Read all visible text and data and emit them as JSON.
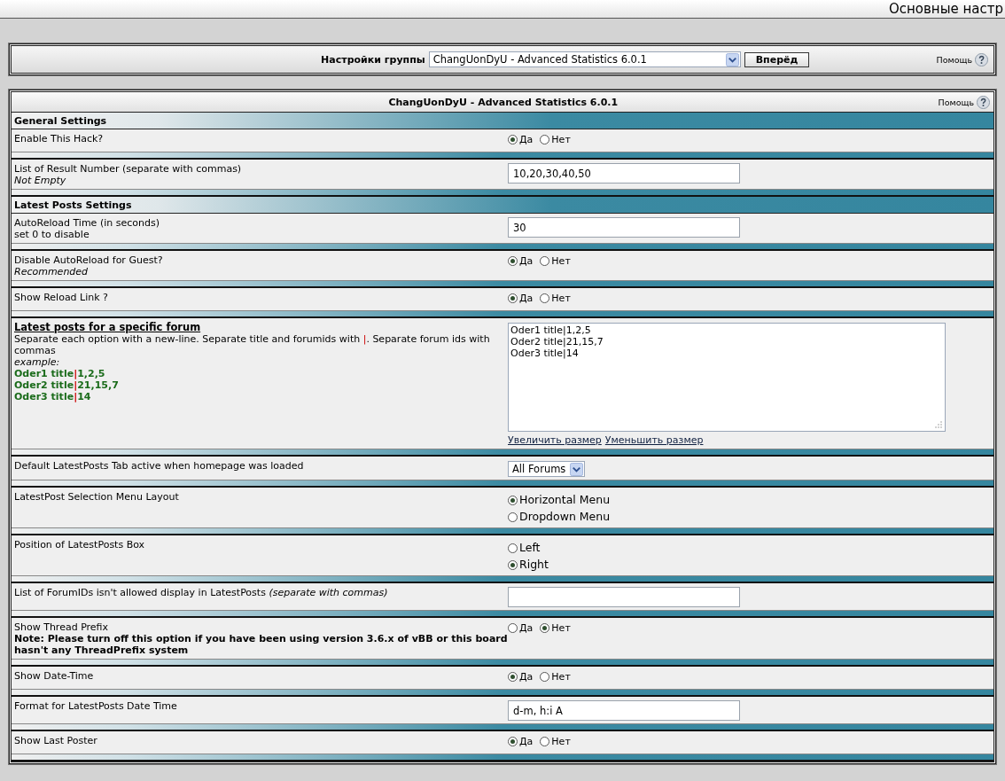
{
  "page_title": "Основные настр",
  "group_bar": {
    "label": "Настройки группы",
    "select": "ChangUonDyU - Advanced Statistics 6.0.1",
    "button": "Вперёд",
    "help": "Помощь"
  },
  "panel": {
    "title": "ChangUonDyU - Advanced Statistics 6.0.1",
    "help": "Помощь"
  },
  "rows": [
    {
      "kind": "section",
      "title": "General Settings"
    },
    {
      "kind": "radio",
      "desc": [
        {
          "kind": "label",
          "text": "Enable This Hack?"
        }
      ],
      "options": [
        {
          "label": "Да",
          "selected": true
        },
        {
          "label": "Нет",
          "selected": false
        }
      ]
    },
    {
      "kind": "text",
      "desc": [
        {
          "kind": "label",
          "text": "List of Result Number (separate with commas)"
        },
        {
          "kind": "hint",
          "text": "Not Empty"
        }
      ],
      "value": "10,20,30,40,50"
    },
    {
      "kind": "section",
      "title": "Latest Posts Settings"
    },
    {
      "kind": "text",
      "desc": [
        {
          "kind": "label",
          "text": "AutoReload Time (in seconds)"
        },
        {
          "kind": "label",
          "text": "set 0 to disable"
        }
      ],
      "value": "30"
    },
    {
      "kind": "radio",
      "desc": [
        {
          "kind": "label",
          "text": "Disable AutoReload for Guest?"
        },
        {
          "kind": "hint",
          "text": "Recommended"
        }
      ],
      "options": [
        {
          "label": "Да",
          "selected": true
        },
        {
          "label": "Нет",
          "selected": false
        }
      ]
    },
    {
      "kind": "radio",
      "desc": [
        {
          "kind": "label",
          "text": "Show Reload Link ?"
        }
      ],
      "options": [
        {
          "label": "Да",
          "selected": true
        },
        {
          "label": "Нет",
          "selected": false
        }
      ]
    },
    {
      "kind": "textarea",
      "desc": [
        {
          "kind": "heading",
          "text": "Latest posts for a specific forum"
        },
        {
          "kind": "sentence",
          "before": "Separate each option with a new-line. Separate title and forumids with ",
          "sep": "|",
          "after": ". Separate forum ids with commas"
        },
        {
          "kind": "hint",
          "text": "example:"
        },
        {
          "kind": "example",
          "before": "Oder1 title",
          "sep": "|",
          "after": "1,2,5"
        },
        {
          "kind": "example",
          "before": "Oder2 title",
          "sep": "|",
          "after": "21,15,7"
        },
        {
          "kind": "example",
          "before": "Oder3 title",
          "sep": "|",
          "after": "14"
        }
      ],
      "lines": [
        "Oder1 title|1,2,5",
        "Oder2 title|21,15,7",
        "Oder3 title|14"
      ],
      "links": [
        "Увеличить размер",
        "Уменьшить размер"
      ]
    },
    {
      "kind": "select",
      "desc": [
        {
          "kind": "label",
          "text": "Default LatestPosts Tab active when homepage was loaded"
        }
      ],
      "value": "All Forums"
    },
    {
      "kind": "radio_stack",
      "desc": [
        {
          "kind": "label",
          "text": "LatestPost Selection Menu Layout"
        }
      ],
      "options": [
        {
          "label": "Horizontal Menu",
          "selected": true
        },
        {
          "label": "Dropdown Menu",
          "selected": false
        }
      ]
    },
    {
      "kind": "radio_stack",
      "desc": [
        {
          "kind": "label",
          "text": "Position of LatestPosts Box"
        }
      ],
      "options": [
        {
          "label": "Left",
          "selected": false
        },
        {
          "label": "Right",
          "selected": true
        }
      ]
    },
    {
      "kind": "text",
      "desc": [
        {
          "kind": "label",
          "text": "List of ForumIDs isn't allowed display in LatestPosts *(separate with commas)*"
        }
      ],
      "value": ""
    },
    {
      "kind": "radio",
      "desc": [
        {
          "kind": "label",
          "text": "Show Thread Prefix"
        },
        {
          "kind": "note",
          "text": "Note: Please turn off this option if you have been using version 3.6.x of vBB or this board hasn't any ThreadPrefix system"
        }
      ],
      "options": [
        {
          "label": "Да",
          "selected": false
        },
        {
          "label": "Нет",
          "selected": true
        }
      ]
    },
    {
      "kind": "radio",
      "desc": [
        {
          "kind": "label",
          "text": "Show Date-Time"
        }
      ],
      "options": [
        {
          "label": "Да",
          "selected": true
        },
        {
          "label": "Нет",
          "selected": false
        }
      ]
    },
    {
      "kind": "text",
      "desc": [
        {
          "kind": "label",
          "text": "Format for LatestPosts Date Time"
        }
      ],
      "value": "d-m, h:i A"
    },
    {
      "kind": "radio",
      "desc": [
        {
          "kind": "label",
          "text": "Show Last Poster"
        }
      ],
      "options": [
        {
          "label": "Да",
          "selected": true
        },
        {
          "label": "Нет",
          "selected": false
        }
      ]
    }
  ]
}
